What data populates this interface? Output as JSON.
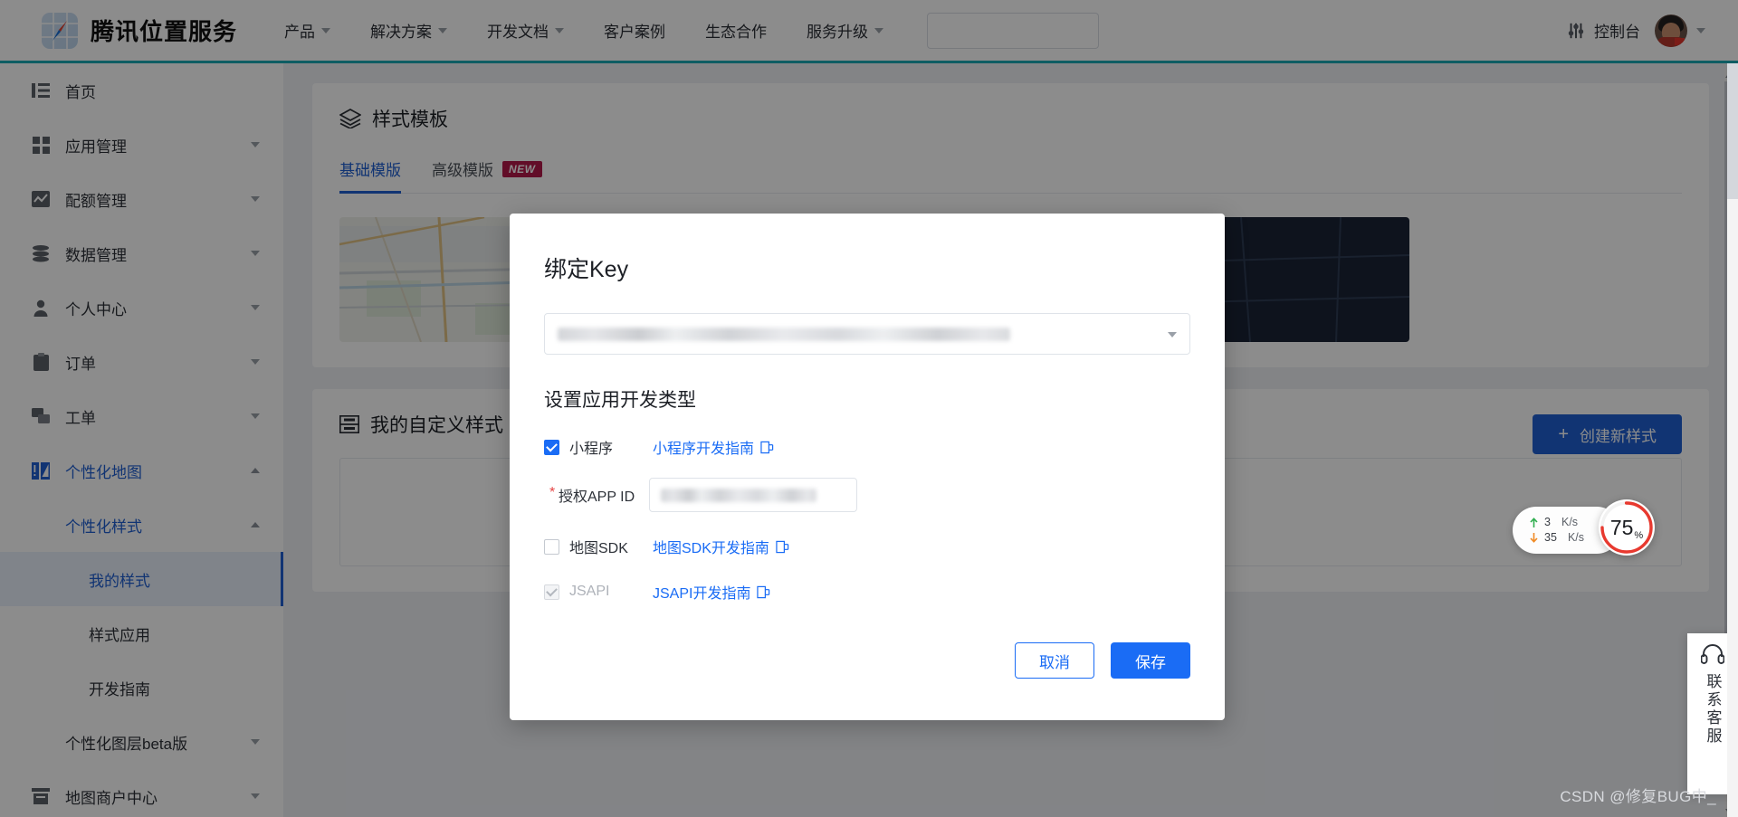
{
  "header": {
    "brand_name": "腾讯位置服务",
    "nav": [
      {
        "label": "产品",
        "has_caret": true
      },
      {
        "label": "解决方案",
        "has_caret": true
      },
      {
        "label": "开发文档",
        "has_caret": true
      },
      {
        "label": "客户案例",
        "has_caret": false
      },
      {
        "label": "生态合作",
        "has_caret": false
      },
      {
        "label": "服务升级",
        "has_caret": true
      }
    ],
    "search_placeholder": "",
    "search_value": "",
    "console_label": "控制台"
  },
  "sidebar": {
    "items": [
      {
        "label": "首页",
        "icon": "list-icon",
        "caret": "none",
        "level": "top"
      },
      {
        "label": "应用管理",
        "icon": "grid-icon",
        "caret": "down",
        "level": "top"
      },
      {
        "label": "配额管理",
        "icon": "chart-icon",
        "caret": "down",
        "level": "top"
      },
      {
        "label": "数据管理",
        "icon": "database-icon",
        "caret": "down",
        "level": "top"
      },
      {
        "label": "个人中心",
        "icon": "user-icon",
        "caret": "down",
        "level": "top"
      },
      {
        "label": "订单",
        "icon": "clipboard-icon",
        "caret": "down",
        "level": "top"
      },
      {
        "label": "工单",
        "icon": "ticket-icon",
        "caret": "down",
        "level": "top"
      },
      {
        "label": "个性化地图",
        "icon": "map-style-icon",
        "caret": "up",
        "level": "top",
        "highlight": true
      },
      {
        "label": "个性化样式",
        "icon": "none",
        "caret": "up",
        "level": "sub",
        "highlight": true
      },
      {
        "label": "我的样式",
        "icon": "none",
        "caret": "none",
        "level": "leaf",
        "active": true
      },
      {
        "label": "样式应用",
        "icon": "none",
        "caret": "none",
        "level": "leaf"
      },
      {
        "label": "开发指南",
        "icon": "none",
        "caret": "none",
        "level": "leaf"
      },
      {
        "label": "个性化图层beta版",
        "icon": "none",
        "caret": "down",
        "level": "sub"
      },
      {
        "label": "地图商户中心",
        "icon": "shop-icon",
        "caret": "down",
        "level": "top"
      }
    ]
  },
  "main": {
    "style_template": {
      "title": "样式模板",
      "tabs": [
        {
          "label": "基础模版",
          "active": true,
          "badge": ""
        },
        {
          "label": "高级模版",
          "active": false,
          "badge": "NEW"
        }
      ]
    },
    "custom_styles": {
      "title": "我的自定义样式",
      "create_button": "创建新样式",
      "create_icon": "plus-icon"
    }
  },
  "modal": {
    "title": "绑定Key",
    "key_select_value": "",
    "key_select_redacted": true,
    "section_title": "设置应用开发类型",
    "options": [
      {
        "name": "小程序",
        "checked": true,
        "disabled": false,
        "link": "小程序开发指南",
        "link_icon": "doc-icon"
      },
      {
        "name": "地图SDK",
        "checked": false,
        "disabled": false,
        "link": "地图SDK开发指南",
        "link_icon": "doc-icon"
      },
      {
        "name": "JSAPI",
        "checked": true,
        "disabled": true,
        "link": "JSAPI开发指南",
        "link_icon": "doc-icon"
      }
    ],
    "appid_label": "授权APP ID",
    "appid_required": true,
    "appid_value": "",
    "appid_redacted": true,
    "cancel_label": "取消",
    "save_label": "保存"
  },
  "widgets": {
    "network": {
      "upload_value": "3",
      "upload_unit": "K/s",
      "download_value": "35",
      "download_unit": "K/s",
      "upload_color": "#2fae4f",
      "download_color": "#f08a24"
    },
    "gauge": {
      "value": "75",
      "suffix": "%",
      "percent": 75,
      "color": "#e8392f"
    },
    "support": {
      "label": "联系客服",
      "icon": "headset-icon"
    }
  },
  "watermark": "CSDN @修复BUG中_",
  "colors": {
    "primary": "#1f5fd1",
    "modal_blue": "#1a6cf5",
    "teal_rule": "#1aa9b5",
    "badge": "#b3194a"
  }
}
